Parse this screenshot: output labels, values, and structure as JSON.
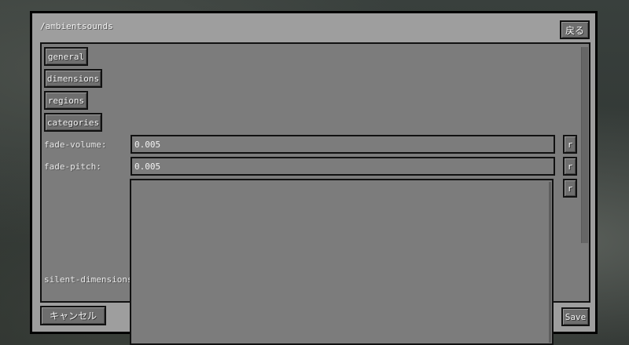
{
  "window": {
    "title": "/ambientsounds"
  },
  "header": {
    "back_label": "戻る"
  },
  "categories": [
    {
      "label": "general"
    },
    {
      "label": "dimensions"
    },
    {
      "label": "regions"
    },
    {
      "label": "categories"
    }
  ],
  "settings": [
    {
      "label": "fade-volume:",
      "value": "0.005",
      "reset_label": "r"
    },
    {
      "label": "fade-pitch:",
      "value": "0.005",
      "reset_label": "r"
    },
    {
      "label": "silent-dimensions:",
      "value": "",
      "reset_label": "r"
    }
  ],
  "footer": {
    "cancel_label": "キャンセル",
    "save_label": "Save"
  }
}
